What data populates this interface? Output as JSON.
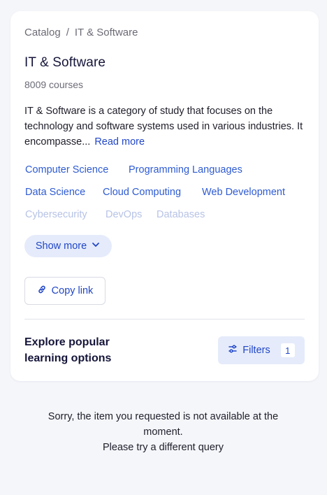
{
  "breadcrumb": {
    "root": "Catalog",
    "separator": "/",
    "current": "IT & Software"
  },
  "title": "IT & Software",
  "course_count": "8009 courses",
  "description": {
    "text": "IT & Software is a category of study that focuses on the technology and software systems used in various industries. It encompasse...",
    "read_more": "Read more"
  },
  "tags": [
    "Computer Science",
    "Programming Languages",
    "Data Science",
    "Cloud Computing",
    "Web Development",
    "Cybersecurity",
    "DevOps",
    "Databases"
  ],
  "show_more": {
    "label": "Show more",
    "icon": "chevron-down-icon"
  },
  "copy_link": {
    "label": "Copy link",
    "icon": "link-icon"
  },
  "explore": {
    "heading": "Explore popular learning options"
  },
  "filters": {
    "label": "Filters",
    "count": "1",
    "icon": "sliders-icon"
  },
  "empty_state": {
    "line1": "Sorry, the item you requested is not available at the moment.",
    "line2": "Please try a different query"
  },
  "colors": {
    "accent": "#2146c7",
    "tag": "#2e5bd3",
    "tag_faded": "#b7c3e6",
    "button_bg": "#e5ebfa",
    "page_bg": "#f5f6fa"
  }
}
